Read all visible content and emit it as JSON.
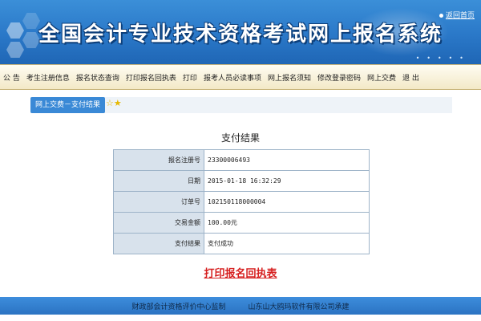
{
  "header": {
    "title": "全国会计专业技术资格考试网上报名系统",
    "home_link": "返回首页"
  },
  "nav": {
    "items": [
      "公 告",
      "考生注册信息",
      "报名状态查询",
      "打印报名回执表",
      "打印",
      "报考人员必读事项",
      "网上报名须知",
      "修改登录密码",
      "网上交费",
      "退 出"
    ]
  },
  "breadcrumb": {
    "label": "网上交费－支付结果"
  },
  "page": {
    "title": "支付结果"
  },
  "result": {
    "rows": [
      {
        "label": "报名注册号",
        "value": "23300006493"
      },
      {
        "label": "日期",
        "value": "2015-01-18 16:32:29"
      },
      {
        "label": "订单号",
        "value": "102150118000004"
      },
      {
        "label": "交易金额",
        "value": "100.00元"
      },
      {
        "label": "支付结果",
        "value": "支付成功"
      }
    ]
  },
  "actions": {
    "print_receipt": "打印报名回执表"
  },
  "footer": {
    "left": "财政部会计资格评价中心监制",
    "right": "山东山大鸥玛软件有限公司承建"
  },
  "colors": {
    "header_blue": "#2a78c8",
    "link_red": "#d61f1f",
    "label_bg": "#d8e2ec"
  }
}
